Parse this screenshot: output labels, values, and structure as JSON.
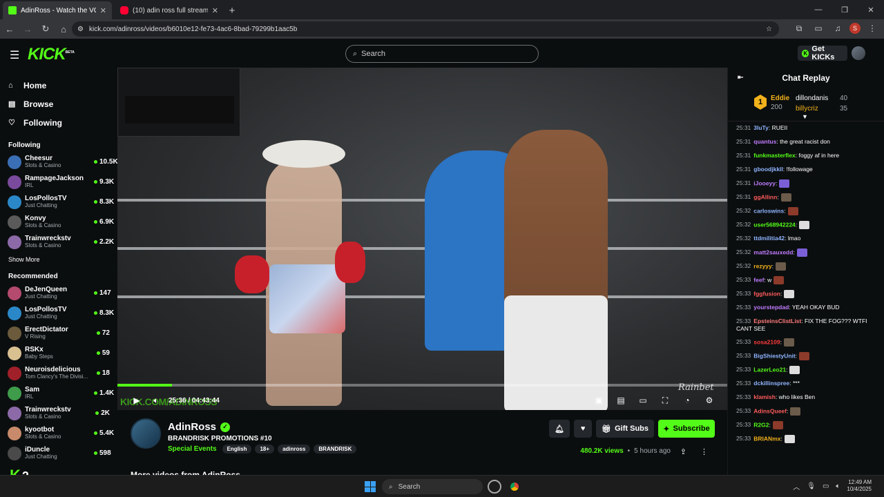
{
  "browser": {
    "tabs": [
      {
        "title": "AdinRoss - Watch the VOD on K",
        "fav_color": "#53fc18",
        "active": true
      },
      {
        "title": "(10) adin ross full stream live - Y",
        "fav_color": "#ff0033",
        "active": false
      }
    ],
    "url": "kick.com/adinross/videos/b6010e12-fe73-4ac6-8bad-79299b1aac5b",
    "profile_initial": "S"
  },
  "header": {
    "logo": "KICK",
    "logo_tag": "BETA",
    "search_placeholder": "Search",
    "get_kicks": "Get KICKs"
  },
  "sidebar": {
    "nav": [
      {
        "label": "Home",
        "icon": "home-icon",
        "glyph": "⌂"
      },
      {
        "label": "Browse",
        "icon": "browse-icon",
        "glyph": "▤"
      },
      {
        "label": "Following",
        "icon": "heart-icon",
        "glyph": "♡"
      }
    ],
    "following_title": "Following",
    "following": [
      {
        "name": "Cheesur",
        "category": "Slots & Casino",
        "viewers": "10.5K",
        "color": "#3b6fb5"
      },
      {
        "name": "RampageJackson",
        "category": "IRL",
        "viewers": "9.3K",
        "color": "#7a4b9c"
      },
      {
        "name": "LosPollosTV",
        "category": "Just Chatting",
        "viewers": "8.3K",
        "color": "#2b88c8"
      },
      {
        "name": "Konvy",
        "category": "Slots & Casino",
        "viewers": "6.9K",
        "color": "#5a5a5a"
      },
      {
        "name": "Trainwreckstv",
        "category": "Slots & Casino",
        "viewers": "2.2K",
        "color": "#8c6aa8"
      }
    ],
    "show_more": "Show More",
    "recommended_title": "Recommended",
    "recommended": [
      {
        "name": "DeJenQueen",
        "category": "Just Chatting",
        "viewers": "147",
        "color": "#b44a6e"
      },
      {
        "name": "LosPollosTV",
        "category": "Just Chatting",
        "viewers": "8.3K",
        "color": "#2b88c8"
      },
      {
        "name": "ErectDictator",
        "category": "V Rising",
        "viewers": "72",
        "color": "#6b5a3c"
      },
      {
        "name": "RSKx",
        "category": "Baby Steps",
        "viewers": "59",
        "color": "#d8c090"
      },
      {
        "name": "Neuroisdelicious",
        "category": "Tom Clancy's The Divisi...",
        "viewers": "18",
        "color": "#a0202a"
      },
      {
        "name": "Sam",
        "category": "IRL",
        "viewers": "1.4K",
        "color": "#3e9c4a"
      },
      {
        "name": "Trainwreckstv",
        "category": "Slots & Casino",
        "viewers": "2K",
        "color": "#8c6aa8"
      },
      {
        "name": "kyootbot",
        "category": "Slots & Casino",
        "viewers": "5.4K",
        "color": "#c88a6a"
      },
      {
        "name": "iDuncle",
        "category": "Just Chatting",
        "viewers": "598",
        "color": "#4a4a4a"
      }
    ]
  },
  "player": {
    "watermark": "KICK.COM/ADINROSS",
    "sponsor": "Rainbet",
    "time": "25:36 / 04:43:44",
    "progress_fraction": 0.09
  },
  "stream": {
    "channel": "AdinRoss",
    "title": "BRANDRISK PROMOTIONS #10",
    "category": "Special Events",
    "tags": [
      "English",
      "18+",
      "adinross",
      "BRANDRISK"
    ],
    "gift_subs": "Gift Subs",
    "subscribe": "Subscribe",
    "views": "480.2K views",
    "sep": "•",
    "age": "5 hours ago",
    "more_videos": "More videos from AdinRoss"
  },
  "chat": {
    "title": "Chat Replay",
    "top": {
      "rank": "1",
      "name": "Eddie",
      "value": "200"
    },
    "others": [
      {
        "name": "dillondanis",
        "value": "40",
        "color": "#fff"
      },
      {
        "name": "billycriz",
        "value": "35",
        "color": "#f2b21b"
      }
    ],
    "messages": [
      {
        "time": "25:31",
        "user": "3luTy",
        "color": "#8fb4ff",
        "text": ": RUEII"
      },
      {
        "time": "25:31",
        "user": "quantus",
        "color": "#c07cff",
        "text": ": the great racist don"
      },
      {
        "time": "25:31",
        "user": "funkmasterflex",
        "color": "#53fc18",
        "text": ": foggy af in here"
      },
      {
        "time": "25:31",
        "user": "gboodjkkll",
        "color": "#8fb4ff",
        "text": ": !followage"
      },
      {
        "time": "25:31",
        "user": "iJooeyy",
        "color": "#c07cff",
        "text": ":"
      },
      {
        "time": "25:31",
        "user": "ggAllinn",
        "color": "#ff5c5c",
        "text": ":"
      },
      {
        "time": "25:32",
        "user": "carloswins",
        "color": "#8fb4ff",
        "text": ":"
      },
      {
        "time": "25:32",
        "user": "user568942224",
        "color": "#53fc18",
        "text": ":"
      },
      {
        "time": "25:32",
        "user": "ttdmilitia42",
        "color": "#8fb4ff",
        "text": ": lmao"
      },
      {
        "time": "25:32",
        "user": "matt2sauxedd",
        "color": "#c07cff",
        "text": ":"
      },
      {
        "time": "25:32",
        "user": "rezyyy",
        "color": "#f2b21b",
        "text": ":"
      },
      {
        "time": "25:33",
        "user": "feef",
        "color": "#c07cff",
        "text": ": w"
      },
      {
        "time": "25:33",
        "user": "fggfusion",
        "color": "#ff5c5c",
        "text": ":"
      },
      {
        "time": "25:33",
        "user": "yourstepdad",
        "color": "#c07cff",
        "text": ": YEAH OKAY BUD"
      },
      {
        "time": "25:33",
        "user": "EpsteinsClistList",
        "color": "#ff7a7a",
        "text": ": FIX THE FOG??? WTFI CANT SEE"
      },
      {
        "time": "25:33",
        "user": "sosa2109",
        "color": "#ff3b3b",
        "text": ":"
      },
      {
        "time": "25:33",
        "user": "BigShiestyUnit",
        "color": "#8fb4ff",
        "text": ":"
      },
      {
        "time": "25:33",
        "user": "LazerLeo21",
        "color": "#53fc18",
        "text": ":"
      },
      {
        "time": "25:33",
        "user": "dckillinspree",
        "color": "#8fb4ff",
        "text": ": ***"
      },
      {
        "time": "25:33",
        "user": "klamish",
        "color": "#ff5c5c",
        "text": ": who likes Ben"
      },
      {
        "time": "25:33",
        "user": "AdinsQueef",
        "color": "#ff5c5c",
        "text": ":"
      },
      {
        "time": "25:33",
        "user": "R2G2",
        "color": "#53fc18",
        "text": ":"
      },
      {
        "time": "25:33",
        "user": "BRIANmx",
        "color": "#f2b21b",
        "text": ":"
      }
    ]
  },
  "taskbar": {
    "search": "Search",
    "time": "12:49 AM",
    "date": "10/4/2025",
    "k2": "2"
  }
}
